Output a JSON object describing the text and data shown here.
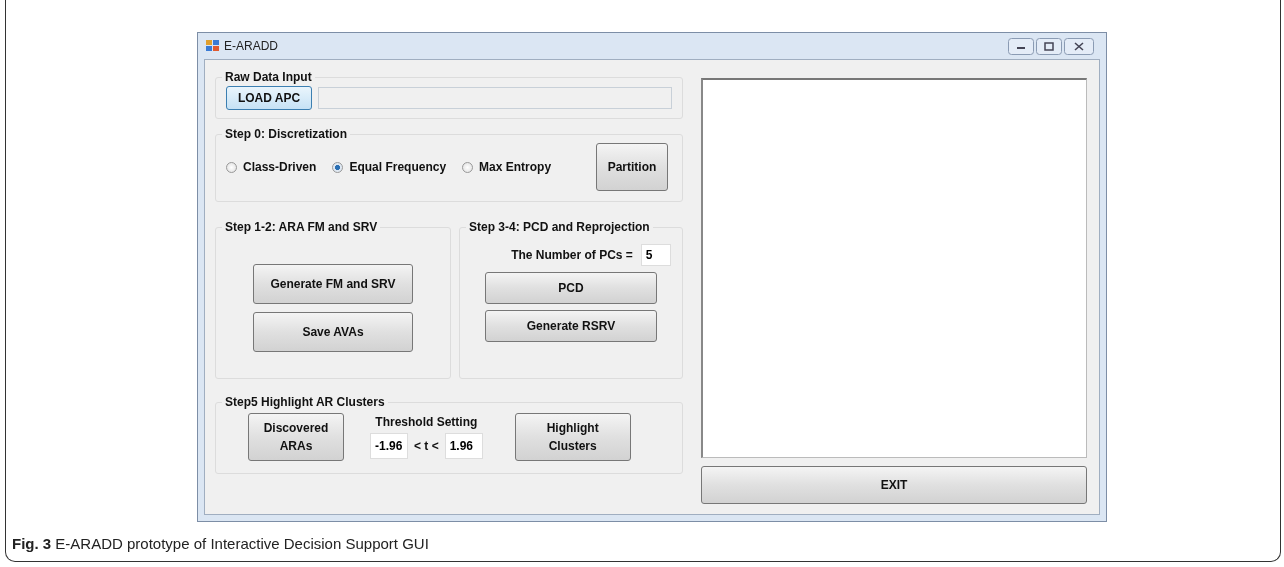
{
  "window": {
    "title": "E-ARADD"
  },
  "raw_data": {
    "title": "Raw Data Input",
    "load_button": "LOAD APC"
  },
  "discretization": {
    "title": "Step 0: Discretization",
    "options": [
      {
        "label": "Class-Driven",
        "selected": false
      },
      {
        "label": "Equal Frequency",
        "selected": true
      },
      {
        "label": "Max Entropy",
        "selected": false
      }
    ],
    "button": "Partition"
  },
  "step12": {
    "title": "Step 1-2: ARA FM and SRV",
    "buttons": [
      "Generate FM and SRV",
      "Save AVAs"
    ]
  },
  "step34": {
    "title": "Step 3-4: PCD and Reprojection",
    "pcs_label": "The Number of PCs =",
    "pcs_value": "5",
    "buttons": [
      "PCD",
      "Generate RSRV"
    ]
  },
  "step5": {
    "title": "Step5 Highlight AR Clusters",
    "discovered_button": "Discovered ARAs",
    "threshold_label": "Threshold Setting",
    "lower": "-1.96",
    "between": "< t <",
    "upper": "1.96",
    "highlight_button": "Highlight Clusters"
  },
  "exit_button": "EXIT",
  "caption": "**Fig. 3** E-ARADD prototype of Interactive Decision Support GUI"
}
